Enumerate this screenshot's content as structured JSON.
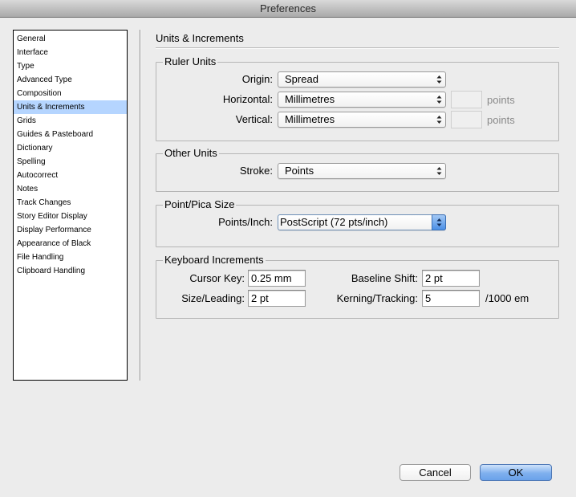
{
  "window": {
    "title": "Preferences"
  },
  "sidebar": {
    "selected_index": 5,
    "items": [
      {
        "label": "General"
      },
      {
        "label": "Interface"
      },
      {
        "label": "Type"
      },
      {
        "label": "Advanced Type"
      },
      {
        "label": "Composition"
      },
      {
        "label": "Units & Increments"
      },
      {
        "label": "Grids"
      },
      {
        "label": "Guides & Pasteboard"
      },
      {
        "label": "Dictionary"
      },
      {
        "label": "Spelling"
      },
      {
        "label": "Autocorrect"
      },
      {
        "label": "Notes"
      },
      {
        "label": "Track Changes"
      },
      {
        "label": "Story Editor Display"
      },
      {
        "label": "Display Performance"
      },
      {
        "label": "Appearance of Black"
      },
      {
        "label": "File Handling"
      },
      {
        "label": "Clipboard Handling"
      }
    ]
  },
  "page": {
    "title": "Units & Increments"
  },
  "ruler_units": {
    "legend": "Ruler Units",
    "origin_label": "Origin:",
    "origin_value": "Spread",
    "horizontal_label": "Horizontal:",
    "horizontal_value": "Millimetres",
    "horizontal_unit": "points",
    "vertical_label": "Vertical:",
    "vertical_value": "Millimetres",
    "vertical_unit": "points"
  },
  "other_units": {
    "legend": "Other Units",
    "stroke_label": "Stroke:",
    "stroke_value": "Points"
  },
  "point_pica": {
    "legend": "Point/Pica Size",
    "points_inch_label": "Points/Inch:",
    "points_inch_value": "PostScript (72 pts/inch)"
  },
  "keyboard_increments": {
    "legend": "Keyboard Increments",
    "cursor_key_label": "Cursor Key:",
    "cursor_key_value": "0.25 mm",
    "size_leading_label": "Size/Leading:",
    "size_leading_value": "2 pt",
    "baseline_shift_label": "Baseline Shift:",
    "baseline_shift_value": "2 pt",
    "kerning_tracking_label": "Kerning/Tracking:",
    "kerning_tracking_value": "5",
    "kerning_tracking_suffix": "/1000 em"
  },
  "buttons": {
    "cancel_label": "Cancel",
    "ok_label": "OK"
  },
  "colors": {
    "selection": "#b5d5ff",
    "ok_button": "#6aa2ea",
    "window_bg": "#ececec"
  }
}
